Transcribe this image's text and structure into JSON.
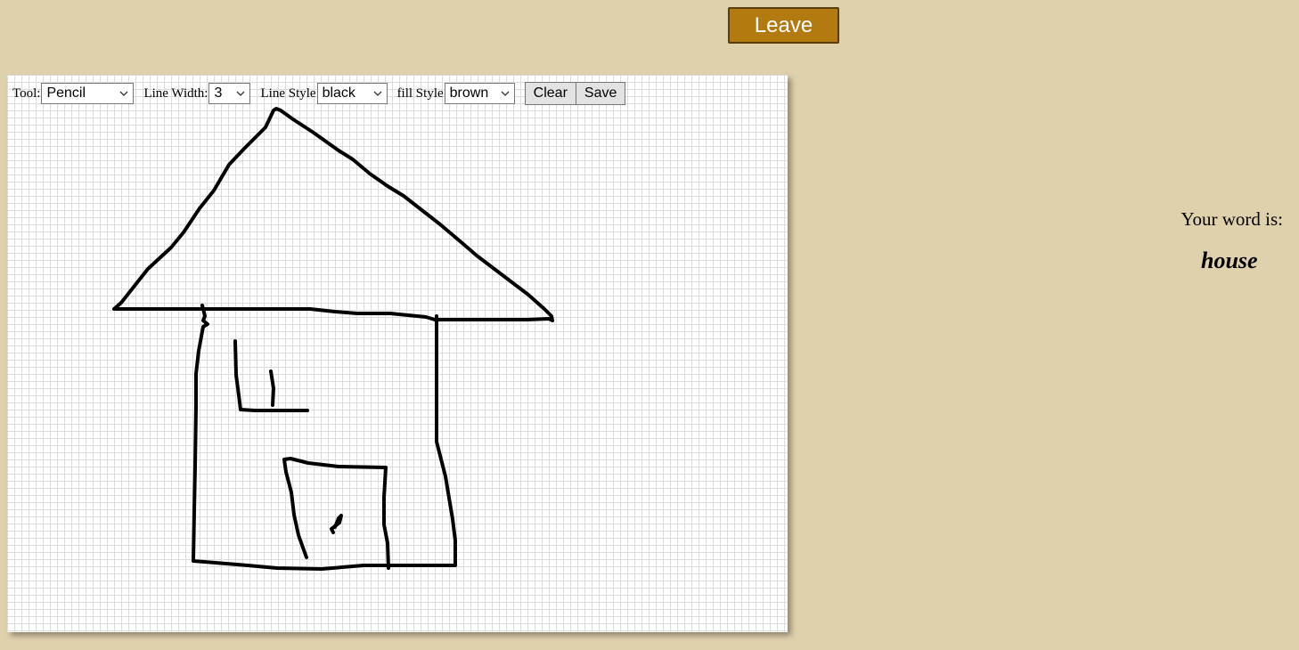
{
  "header": {
    "leave_label": "Leave"
  },
  "toolbar": {
    "tool_label": "Tool:",
    "tool_value": "Pencil",
    "line_width_label": "Line Width:",
    "line_width_value": "3",
    "line_style_label": "Line Style",
    "line_style_value": "black",
    "fill_style_label": "fill Style",
    "fill_style_value": "brown",
    "clear_label": "Clear",
    "save_label": "Save"
  },
  "icons": {
    "dropdown": "chevron-down-icon"
  },
  "canvas": {
    "drawing_subject": "house",
    "stroke_color": "#000000"
  },
  "sidebar": {
    "word_prompt": "Your word is:",
    "word": "house"
  },
  "colors": {
    "background": "#e0d1ad",
    "leave_button": "#b37a10",
    "grid_line": "#dcdcdc"
  }
}
